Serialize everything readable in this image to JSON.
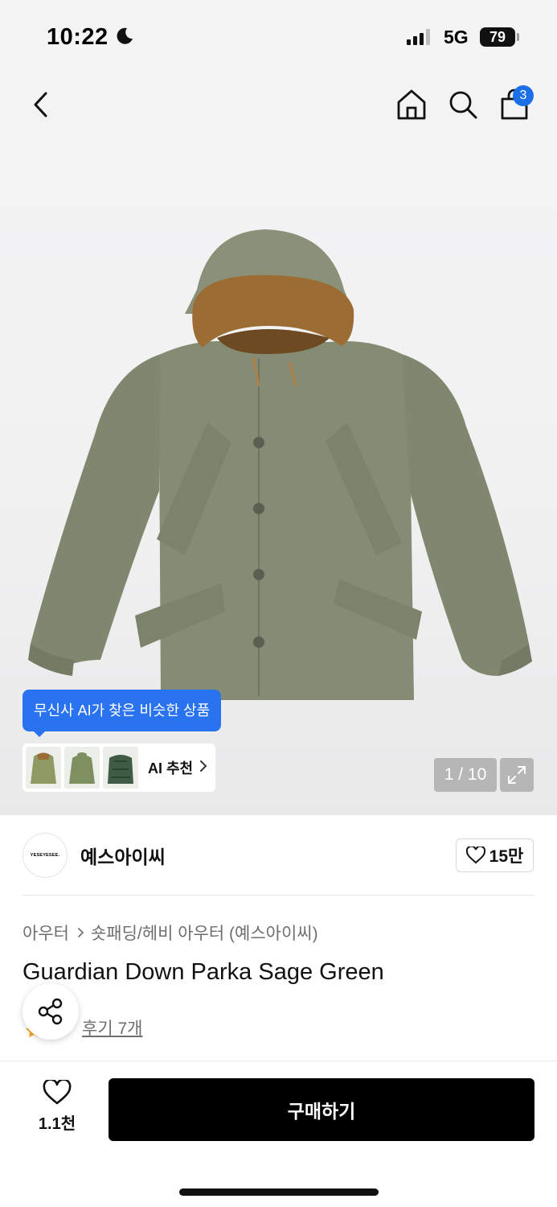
{
  "status_bar": {
    "time": "10:22",
    "network": "5G",
    "battery": "79"
  },
  "nav": {
    "cart_count": "3"
  },
  "gallery": {
    "ai_tooltip": "무신사 AI가 찾은 비슷한 상품",
    "ai_label": "AI 추천",
    "counter": "1 / 10"
  },
  "brand": {
    "logo_text": "YESEYESEE.",
    "name": "예스아이씨",
    "likes": "15만"
  },
  "product": {
    "breadcrumb": [
      "아우터",
      "숏패딩/헤비 아우터 (예스아이씨)"
    ],
    "title": "Guardian Down Parka Sage Green",
    "reviews_label": "후기 7개"
  },
  "bottom_bar": {
    "wish_count": "1.1천",
    "buy_label": "구매하기"
  },
  "colors": {
    "accent": "#2a73f0",
    "badge": "#1c6fe6",
    "buy_button": "#000000",
    "parka": "#8a9178",
    "fur": "#9b6c34"
  }
}
